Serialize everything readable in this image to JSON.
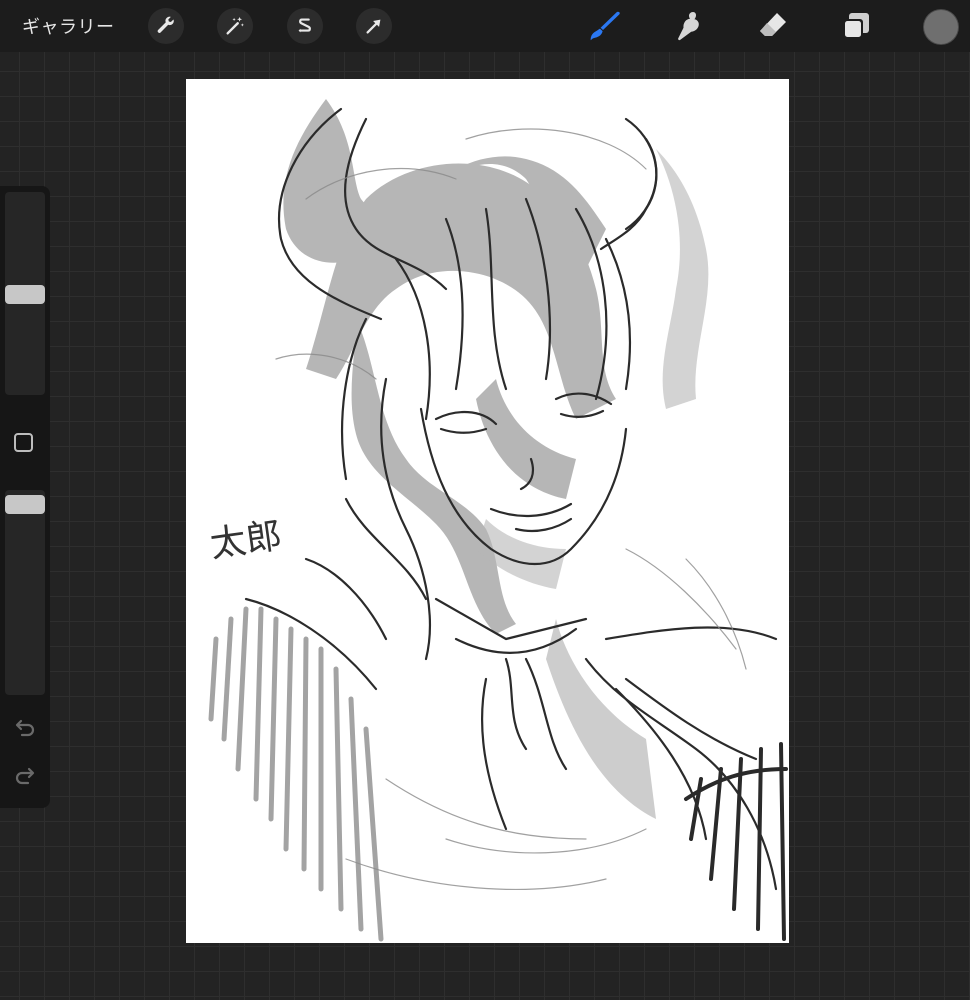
{
  "topbar": {
    "gallery_label": "ギャラリー",
    "left_tools": [
      "wrench-icon",
      "magic-wand-icon",
      "selection-icon",
      "transform-arrow-icon"
    ],
    "right_tools": [
      "brush-icon",
      "smudge-icon",
      "eraser-icon",
      "layers-icon"
    ],
    "active_tool": "brush",
    "active_color": "#2b78f2",
    "current_color": "#6f6f6f"
  },
  "sidebar": {
    "brush_size_slider": "size-slider",
    "opacity_slider": "opacity-slider",
    "modify_button": "modify-square-icon",
    "undo": "undo-icon",
    "redo": "redo-icon"
  },
  "canvas": {
    "signature_text": "太郎"
  }
}
